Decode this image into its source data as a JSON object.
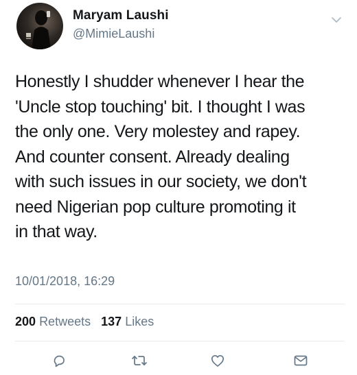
{
  "tweet": {
    "author_name": "Maryam Laushi",
    "author_handle": "@MimieLaushi",
    "text": "Honestly I shudder whenever I hear the\n'Uncle stop touching' bit. I thought I was\nthe only one. Very molestey and rapey.\nAnd counter consent. Already dealing\nwith such issues in our society, we don't\nneed Nigerian pop culture promoting it\nin that way.",
    "timestamp": "10/01/2018, 16:29",
    "retweets_count": "200",
    "retweets_label": "Retweets",
    "likes_count": "137",
    "likes_label": "Likes"
  },
  "icons": {
    "menu": "chevron-down-icon",
    "reply": "reply-icon",
    "retweet": "retweet-icon",
    "like": "heart-icon",
    "message": "envelope-icon"
  },
  "colors": {
    "text_primary": "#14171a",
    "text_secondary": "#657786",
    "icon": "#657786",
    "divider": "#e6ecf0"
  }
}
